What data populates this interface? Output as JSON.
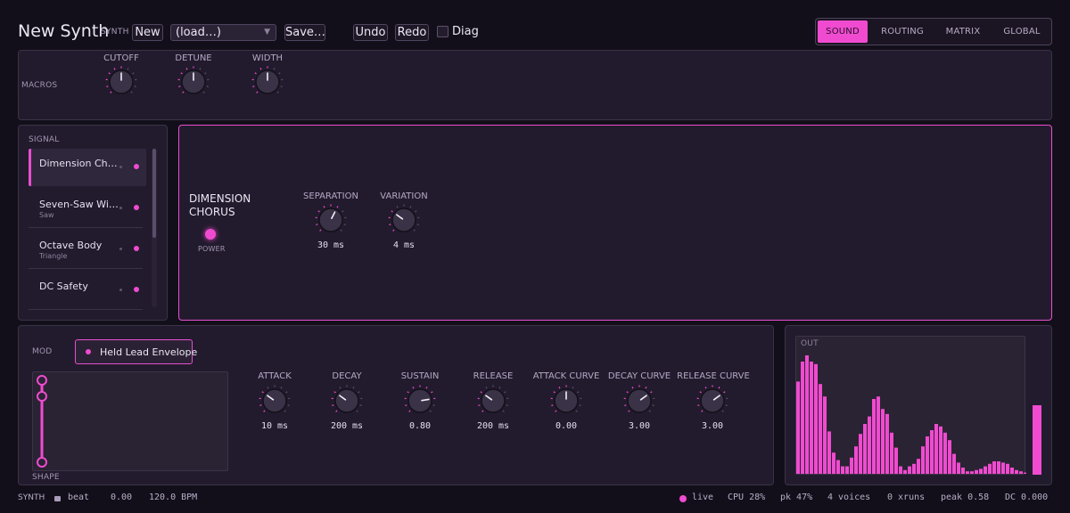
{
  "header": {
    "title": "New Synth",
    "synth_tag": "SYNTH",
    "new_label": "New",
    "load_value": "(load…)",
    "save_label": "Save…",
    "undo_label": "Undo",
    "redo_label": "Redo",
    "diag_label": "Diag",
    "diag_checked": false
  },
  "nav": {
    "tabs": [
      {
        "label": "SOUND",
        "active": true
      },
      {
        "label": "ROUTING",
        "active": false
      },
      {
        "label": "MATRIX",
        "active": false
      },
      {
        "label": "GLOBAL",
        "active": false
      }
    ]
  },
  "macros": {
    "label": "MACROS",
    "knobs": [
      {
        "label": "CUTOFF",
        "value": 0.5
      },
      {
        "label": "DETUNE",
        "value": 0.5
      },
      {
        "label": "WIDTH",
        "value": 0.5
      }
    ]
  },
  "signal": {
    "label": "SIGNAL",
    "items": [
      {
        "name": "Dimension Ch…",
        "sub": "",
        "selected": true
      },
      {
        "name": "Seven-Saw Wi…",
        "sub": "Saw",
        "selected": false
      },
      {
        "name": "Octave Body",
        "sub": "Triangle",
        "selected": false
      },
      {
        "name": "DC Safety",
        "sub": "",
        "selected": false
      }
    ]
  },
  "effect": {
    "title_line1": "DIMENSION",
    "title_line2": "CHORUS",
    "power_label": "POWER",
    "power_on": true,
    "knobs": [
      {
        "label": "SEPARATION",
        "value_text": "30 ms",
        "value": 0.6
      },
      {
        "label": "VARIATION",
        "value_text": "4 ms",
        "value": 0.3
      }
    ]
  },
  "mod": {
    "label": "MOD",
    "source": "Held Lead Envelope",
    "shape_label": "SHAPE",
    "knobs": [
      {
        "label": "ATTACK",
        "value_text": "10 ms",
        "value": 0.3
      },
      {
        "label": "DECAY",
        "value_text": "200 ms",
        "value": 0.3
      },
      {
        "label": "SUSTAIN",
        "value_text": "0.80",
        "value": 0.8
      },
      {
        "label": "RELEASE",
        "value_text": "200 ms",
        "value": 0.3
      },
      {
        "label": "ATTACK CURVE",
        "value_text": "0.00",
        "value": 0.5
      },
      {
        "label": "DECAY CURVE",
        "value_text": "3.00",
        "value": 0.7
      },
      {
        "label": "RELEASE CURVE",
        "value_text": "3.00",
        "value": 0.7
      }
    ]
  },
  "out": {
    "label": "OUT",
    "level": 0.5,
    "spectrum": [
      0.74,
      0.9,
      0.95,
      0.9,
      0.88,
      0.72,
      0.62,
      0.34,
      0.17,
      0.11,
      0.06,
      0.06,
      0.13,
      0.22,
      0.32,
      0.4,
      0.46,
      0.6,
      0.62,
      0.52,
      0.48,
      0.33,
      0.21,
      0.06,
      0.03,
      0.06,
      0.08,
      0.12,
      0.22,
      0.3,
      0.35,
      0.4,
      0.38,
      0.33,
      0.27,
      0.16,
      0.09,
      0.05,
      0.02,
      0.02,
      0.03,
      0.04,
      0.06,
      0.08,
      0.1,
      0.1,
      0.09,
      0.08,
      0.05,
      0.03,
      0.02,
      0.01
    ]
  },
  "status": {
    "label": "SYNTH",
    "beat_label": "beat",
    "beat_value": "0.00",
    "bpm": "120.0 BPM",
    "live": "live",
    "cpu": "CPU 28%",
    "pk": "pk 47%",
    "voices": "4 voices",
    "xruns": "0 xruns",
    "peak": "peak 0.58",
    "dc": "DC 0.000"
  },
  "colors": {
    "accent": "#f04bd0",
    "background": "#130f1a",
    "panel": "#221b2d"
  }
}
